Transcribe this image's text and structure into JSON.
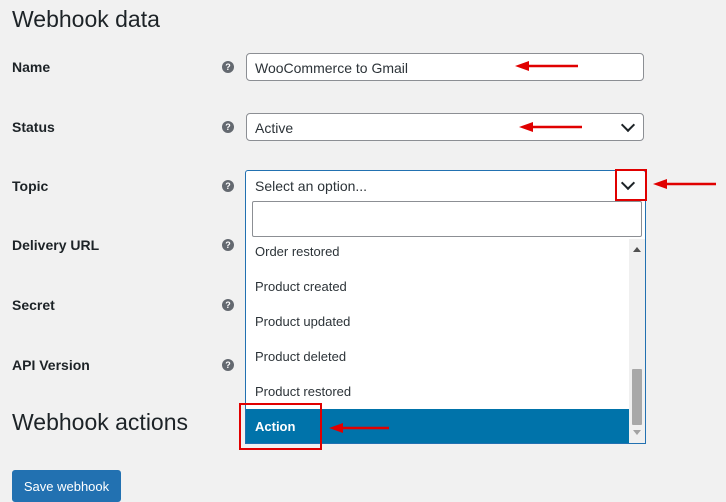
{
  "webhook_data": {
    "title": "Webhook data",
    "fields": {
      "name": {
        "label": "Name",
        "value": "WooCommerce to Gmail"
      },
      "status": {
        "label": "Status",
        "value": "Active"
      },
      "topic": {
        "label": "Topic",
        "placeholder": "Select an option..."
      },
      "delivery_url": {
        "label": "Delivery URL"
      },
      "secret": {
        "label": "Secret"
      },
      "api_version": {
        "label": "API Version"
      }
    },
    "help_icon": "?"
  },
  "topic_dropdown": {
    "search_value": "",
    "options": [
      "Order restored",
      "Product created",
      "Product updated",
      "Product deleted",
      "Product restored",
      "Action"
    ],
    "highlighted": "Action"
  },
  "webhook_actions": {
    "title": "Webhook actions",
    "save_label": "Save webhook"
  },
  "icons": [
    "help-icon",
    "chevron-down-icon",
    "scroll-up-icon",
    "scroll-down-icon",
    "arrow-annotation-icon"
  ],
  "colors": {
    "accent": "#2271b1",
    "selected_option": "#0073aa",
    "annotation": "#e00000",
    "background": "#f1f1f1"
  }
}
